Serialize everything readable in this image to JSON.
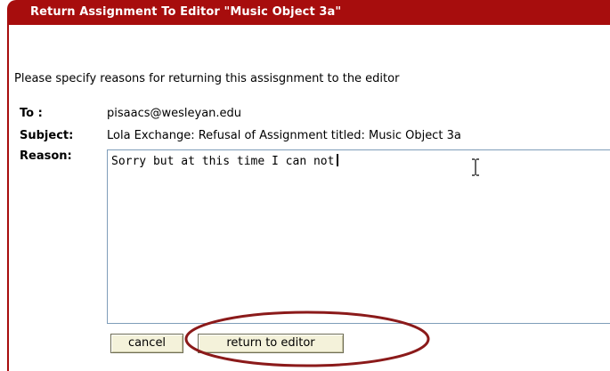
{
  "dialog": {
    "title": "Return Assignment To Editor \"Music Object 3a\"",
    "instructions": "Please specify reasons for returning this assisgnment to the editor",
    "accent_color": "#a70d0d"
  },
  "fields": {
    "to_label": "To :",
    "to_value": "pisaacs@wesleyan.edu",
    "subject_label": "Subject:",
    "subject_value": "Lola Exchange: Refusal of Assignment titled: Music Object 3a",
    "reason_label": "Reason:",
    "reason_value": "Sorry but at this time I can not"
  },
  "buttons": {
    "cancel_label": "cancel",
    "return_label": "return to editor"
  },
  "annotation": {
    "highlight_color": "#8b1a1a",
    "highlight_target": "return to editor"
  }
}
